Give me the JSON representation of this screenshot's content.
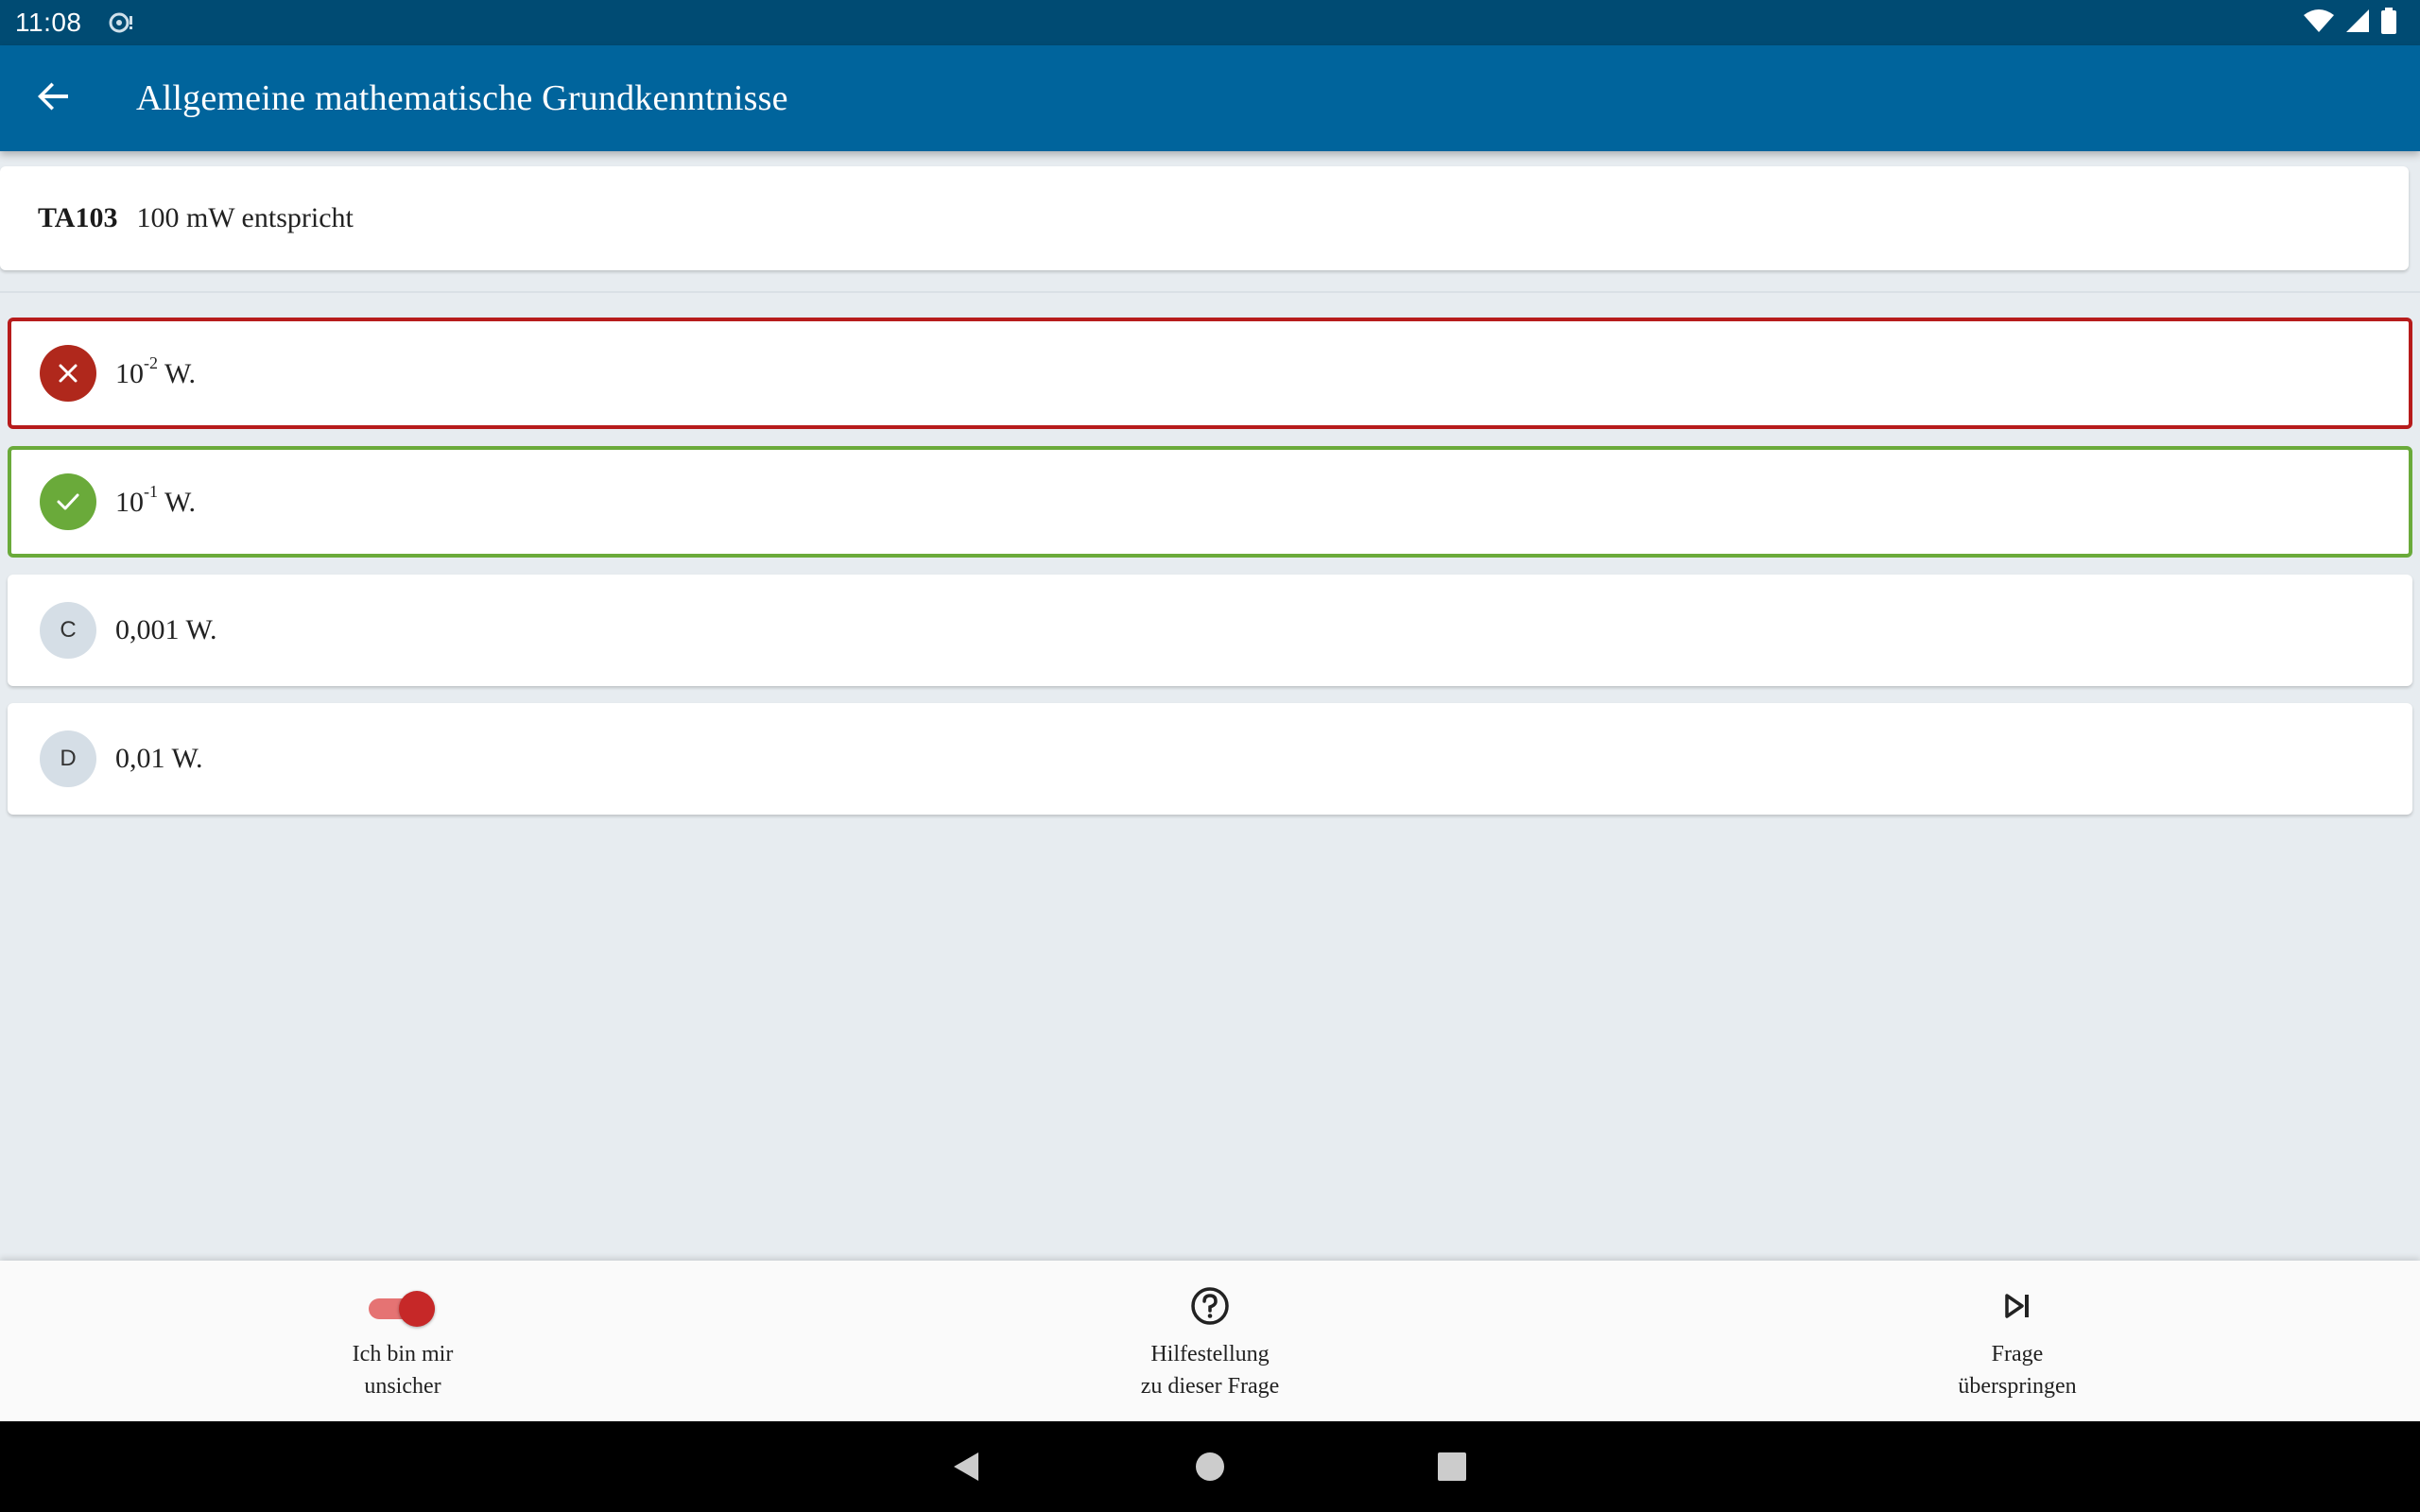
{
  "status_bar": {
    "time": "11:08",
    "icons": [
      "sync-icon",
      "wifi-icon",
      "signal-icon",
      "battery-icon"
    ]
  },
  "app_bar": {
    "back_icon": "arrow-back-icon",
    "title": "Allgemeine mathematische Grundkenntnisse"
  },
  "question": {
    "id": "TA103",
    "text": "100 mW entspricht"
  },
  "answers": [
    {
      "badge": "close-icon",
      "base": "10",
      "exponent": "-2",
      "suffix": " W.",
      "state": "wrong"
    },
    {
      "badge": "check-icon",
      "base": "10",
      "exponent": "-1",
      "suffix": " W.",
      "state": "correct"
    },
    {
      "badge": "C",
      "text": "0,001 W.",
      "state": "neutral"
    },
    {
      "badge": "D",
      "text": "0,01 W.",
      "state": "neutral"
    }
  ],
  "bottom_bar": {
    "unsure": {
      "label_line1": "Ich bin mir",
      "label_line2": "unsicher",
      "toggle_on": true
    },
    "help": {
      "icon": "help-circle-icon",
      "label_line1": "Hilfestellung",
      "label_line2": "zu dieser Frage"
    },
    "skip": {
      "icon": "skip-next-icon",
      "label_line1": "Frage",
      "label_line2": "überspringen"
    }
  },
  "nav_bar": {
    "buttons": [
      "nav-back-icon",
      "nav-home-icon",
      "nav-recents-icon"
    ]
  },
  "colors": {
    "status_bar": "#004b73",
    "app_bar": "#00649c",
    "background": "#e7ecf0",
    "wrong": "#b71c1c",
    "correct": "#6aaa3a",
    "toggle_thumb": "#c62828"
  }
}
